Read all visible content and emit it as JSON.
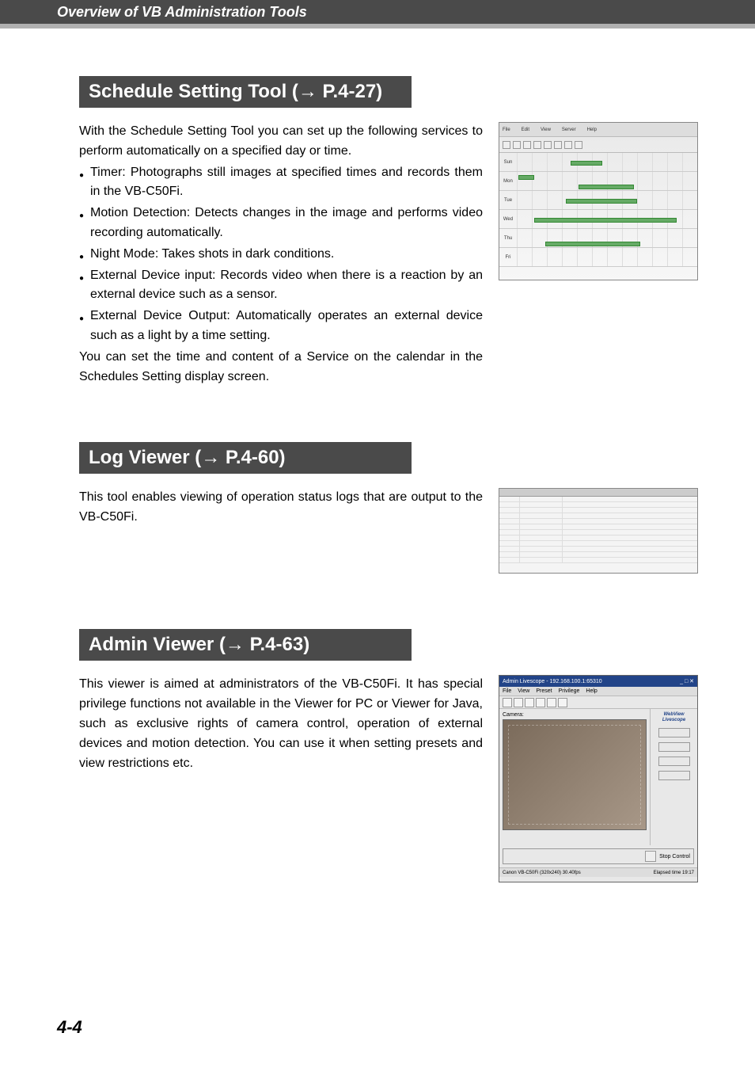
{
  "header": {
    "title": "Overview of VB Administration Tools"
  },
  "sections": {
    "schedule": {
      "banner": "Schedule Setting Tool (→ P.4-27)",
      "intro": "With the Schedule Setting Tool you can set up the following services to perform automatically on a specified day or time.",
      "bullets": [
        "Timer: Photographs still images at specified times and records them in the VB-C50Fi.",
        "Motion Detection: Detects changes in the image and performs video recording automatically.",
        "Night Mode: Takes shots in dark conditions.",
        "External Device input: Records video when there is a reaction by an external device such as a sensor.",
        "External Device Output: Automatically operates an external device such as a light by a time setting."
      ],
      "outro": "You can set the time and content of a Service on the calendar in the Schedules Setting display screen.",
      "fig_rows": [
        "Sun",
        "Mon",
        "Tue",
        "Wed",
        "Thu",
        "Fri"
      ],
      "fig_menu": [
        "File",
        "Edit",
        "View",
        "Server",
        "Help"
      ]
    },
    "log": {
      "banner": "Log Viewer (→ P.4-60)",
      "text": "This tool enables viewing of operation status logs that are output to the VB-C50Fi."
    },
    "admin": {
      "banner": "Admin Viewer (→ P.4-63)",
      "text": "This viewer is aimed at administrators of the VB-C50Fi. It has special privilege functions not available in the Viewer for PC or Viewer for Java, such as exclusive rights of camera control, operation of external devices and motion detection. You can use it when setting presets and view restrictions etc.",
      "fig_title": "Admin Livescope - 192.168.100.1:65310",
      "fig_menu": [
        "File",
        "View",
        "Preset",
        "Privilege",
        "Help"
      ],
      "fig_camera_label": "Camera:",
      "fig_brand_top": "WebView",
      "fig_brand_bottom": "Livescope",
      "fig_stop": "Stop Control",
      "fig_status_left": "Canon VB-C50Fi (320x240) 30.40fps",
      "fig_status_right": "Elapsed time 19:17"
    }
  },
  "page_number": "4-4"
}
